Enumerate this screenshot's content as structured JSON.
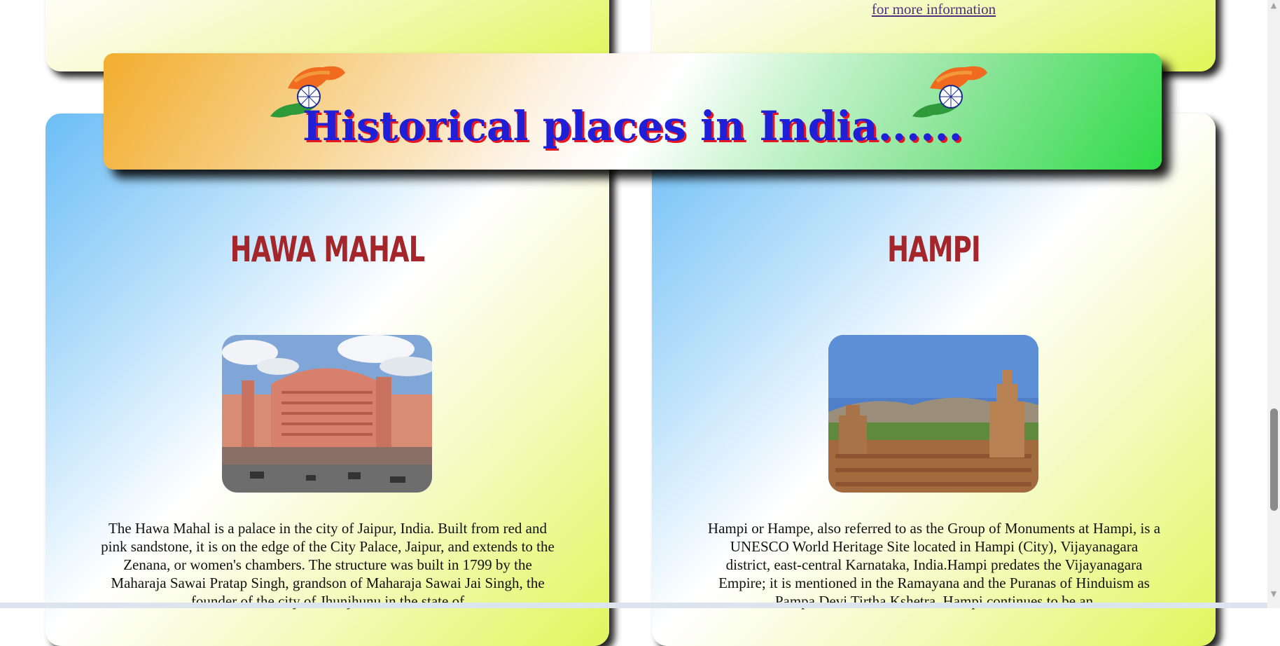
{
  "top_section": {
    "right_link": "for more information"
  },
  "banner": {
    "title": "Historical places in India......"
  },
  "cards": [
    {
      "title": "HAWA MAHAL",
      "description": "The Hawa Mahal is a palace in the city of Jaipur, India. Built from red and pink sandstone, it is on the edge of the City Palace, Jaipur, and extends to the Zenana, or women's chambers. The structure was built in 1799 by the Maharaja Sawai Pratap Singh, grandson of Maharaja Sawai Jai Singh, the founder of the city of Jhunjhunu in the state of"
    },
    {
      "title": "HAMPI",
      "description": "Hampi or Hampe, also referred to as the Group of Monuments at Hampi, is a UNESCO World Heritage Site located in Hampi (City), Vijayanagara district, east-central Karnataka, India.Hampi predates the Vijayanagara Empire; it is mentioned in the Ramayana and the Puranas of Hinduism as Pampa Devi Tirtha Kshetra. Hampi continues to be an"
    }
  ],
  "scrollbar": {
    "up_icon": "▲",
    "down_icon": "▼"
  },
  "colors": {
    "banner_title": "#1f1fd8",
    "banner_title_shadow": "#e8171f",
    "card_title": "#a5262a"
  }
}
